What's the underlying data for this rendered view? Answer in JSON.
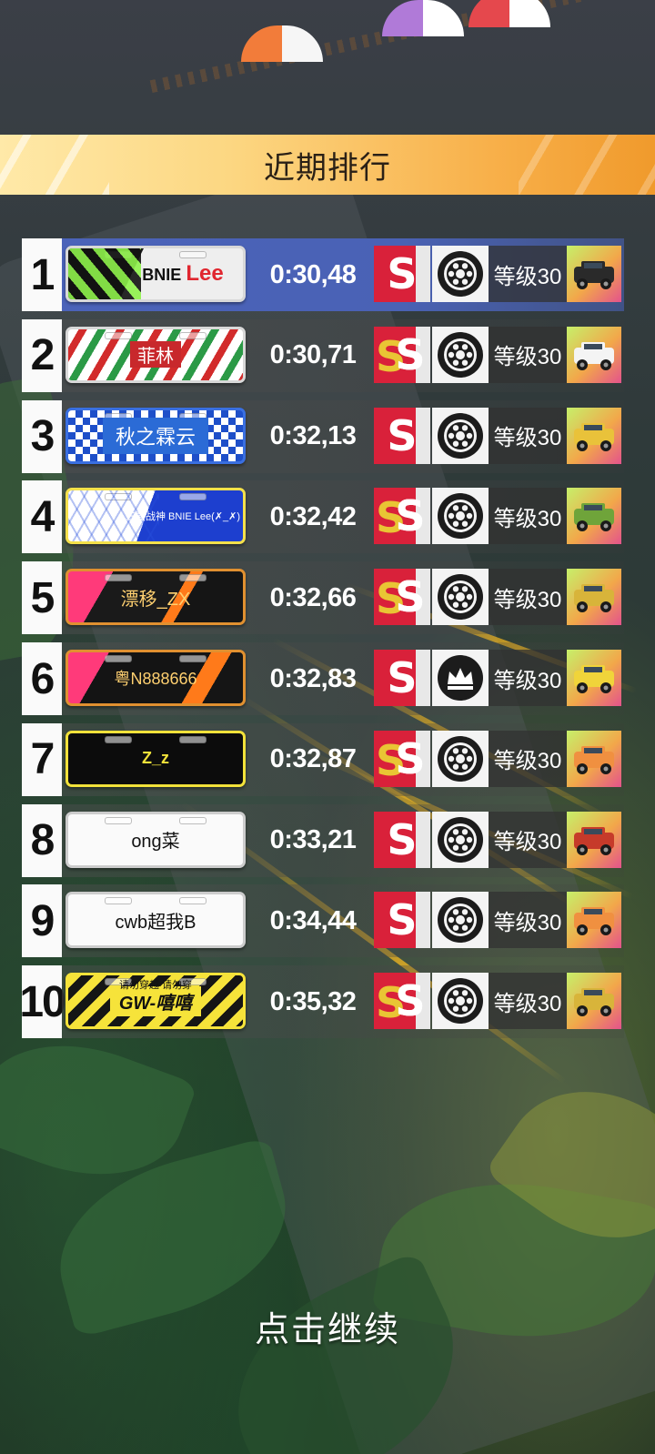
{
  "header": {
    "title": "近期排行"
  },
  "rows": [
    {
      "rank": "1",
      "plate": "BNIE",
      "plate_red": "Lee",
      "time": "0:30,48",
      "grade": "S",
      "level": "等级30",
      "car_color": "#2a2a2a"
    },
    {
      "rank": "2",
      "plate": "菲林",
      "time": "0:30,71",
      "grade": "SS",
      "level": "等级30",
      "car_color": "#f4f4f4"
    },
    {
      "rank": "3",
      "plate": "秋之霖云",
      "time": "0:32,13",
      "grade": "S",
      "level": "等级30",
      "car_color": "#e9c23a"
    },
    {
      "rank": "4",
      "plate": "三菱战神 BNIE Lee(✗_✗)",
      "time": "0:32,42",
      "grade": "SS",
      "level": "等级30",
      "car_color": "#6fa43a"
    },
    {
      "rank": "5",
      "plate": "漂移_ZX",
      "time": "0:32,66",
      "grade": "SS",
      "level": "等级30",
      "car_color": "#d8b43a"
    },
    {
      "rank": "6",
      "plate": "粤N888666",
      "time": "0:32,83",
      "grade": "S",
      "level": "等级30",
      "car_color": "#f0d43a"
    },
    {
      "rank": "7",
      "plate": "Z_z",
      "time": "0:32,87",
      "grade": "SS",
      "level": "等级30",
      "car_color": "#f09040"
    },
    {
      "rank": "8",
      "plate": "ong菜",
      "time": "0:33,21",
      "grade": "S",
      "level": "等级30",
      "car_color": "#c63a2a"
    },
    {
      "rank": "9",
      "plate": "cwb超我B",
      "time": "0:34,44",
      "grade": "S",
      "level": "等级30",
      "car_color": "#f09040"
    },
    {
      "rank": "10",
      "plate": "GW-嘻嘻",
      "plate_top": "请勿穿越 请勿穿",
      "time": "0:35,32",
      "grade": "SS",
      "level": "等级30",
      "car_color": "#d8b43a"
    }
  ],
  "footer": {
    "continue_label": "点击继续"
  },
  "colors": {
    "highlight_row": "#4a62b5",
    "grade_red": "#d9213a",
    "grade_gold": "#e9c534"
  },
  "icons": {
    "wheel": "tire-icon",
    "crown": "crown-icon"
  }
}
